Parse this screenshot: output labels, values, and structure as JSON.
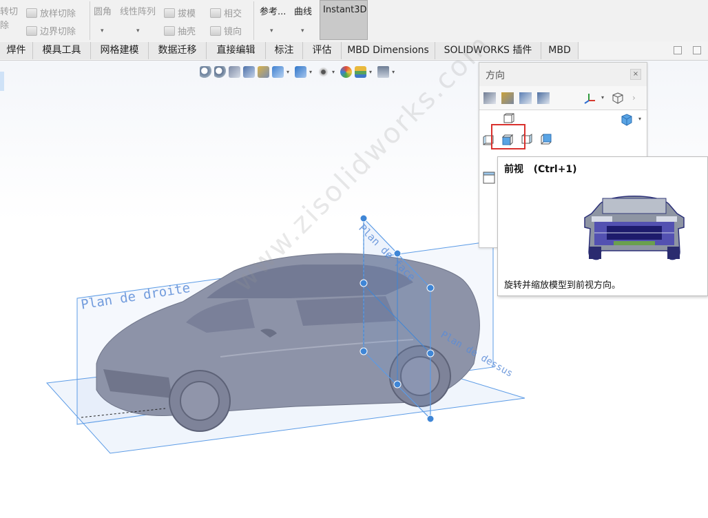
{
  "ribbon": {
    "items": [
      {
        "label": "转切",
        "state": "disabled"
      },
      {
        "label": "除",
        "state": "disabled"
      },
      {
        "label": "放样切除",
        "icon": "loft-cut-icon",
        "state": "disabled"
      },
      {
        "label": "边界切除",
        "icon": "boundary-cut-icon",
        "state": "disabled"
      },
      {
        "label": "圆角",
        "state": "disabled"
      },
      {
        "label": "线性阵列",
        "state": "disabled"
      },
      {
        "label": "拔模",
        "icon": "draft-icon",
        "state": "disabled"
      },
      {
        "label": "相交",
        "icon": "intersect-icon",
        "state": "disabled"
      },
      {
        "label": "抽壳",
        "icon": "shell-icon",
        "state": "disabled"
      },
      {
        "label": "镜向",
        "icon": "mirror-icon",
        "state": "disabled"
      },
      {
        "label": "参考...",
        "state": "enabled"
      },
      {
        "label": "曲线",
        "state": "enabled"
      },
      {
        "label": "Instant3D",
        "state": "active"
      }
    ]
  },
  "tabs": [
    "焊件",
    "模具工具",
    "网格建模",
    "数据迁移",
    "直接编辑",
    "标注",
    "评估",
    "MBD Dimensions",
    "SOLIDWORKS 插件",
    "MBD"
  ],
  "heads_up_toolbar": {
    "icons": [
      "zoom-to-fit-icon",
      "zoom-to-area-icon",
      "previous-view-icon",
      "section-view-icon",
      "dynamic-annotation-icon",
      "view-orientation-icon",
      "display-style-icon",
      "hide-show-items-icon",
      "edit-appearance-icon",
      "apply-scene-icon",
      "view-settings-icon"
    ]
  },
  "viewport": {
    "planes": {
      "right": "Plan de droite",
      "front": "Plan de face",
      "top": "Plan de dessus"
    },
    "watermark": "www.zisolidworks.com",
    "colors": {
      "model": "#8d93a8",
      "plane_edge": "#5b9be6",
      "handle": "#3f86d6"
    }
  },
  "orientation_panel": {
    "title": "方向",
    "close": "×",
    "selected_view": "front",
    "highlight_color": "#d9302c"
  },
  "tooltip": {
    "title": "前视   (Ctrl+1)",
    "description": "旋转并缩放模型到前视方向。"
  }
}
